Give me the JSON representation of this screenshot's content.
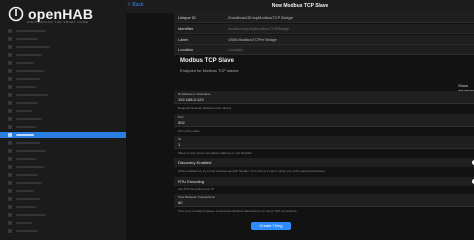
{
  "app": {
    "logo_text": "openHAB",
    "logo_sub": "EMPOWERING THE SMART HOME"
  },
  "header": {
    "back_label": "Back",
    "title": "New Modbus TCP Slave"
  },
  "thing": {
    "rows": [
      {
        "label": "Unique ID",
        "value": "ZmodbusUID:tcpModbusTCP Bridge"
      },
      {
        "label": "Identifier",
        "value": "modbus:tcp:tcpModbusTCPBridge"
      },
      {
        "label": "Label",
        "value": "OWA ModbusTCPer Bridge"
      },
      {
        "label": "Location",
        "value": "Location"
      }
    ]
  },
  "section": {
    "title": "Modbus TCP Slave",
    "subtitle": "Endpoint for Modbus TCP slaves",
    "show_advanced": "Show advanced"
  },
  "fields": {
    "ip": {
      "label": "IP Address or Hostname",
      "value": "192.168.0.123",
      "help": "Required Network address of the device"
    },
    "port": {
      "label": "Port",
      "value": "502",
      "help": "Port of the slave"
    },
    "id": {
      "label": "ID",
      "value": "1",
      "help": "Slave id. Also known as station address or unit identifier"
    },
    "timeout": {
      "label": "Time Between Transactions",
      "value": "60",
      "help": "Time (ms) to delay between consecutive Modbus transactions (on same TCP connection)"
    }
  },
  "toggles": {
    "discovery": {
      "label": "Discovery Enabled",
      "help": "When enabled we try to find a device specific handler. Turn this on if you're using one of the supported devices."
    },
    "rtu": {
      "label": "RTU Encoding",
      "help": "Use RTU Encoding over IP"
    }
  },
  "actions": {
    "create_label": "Create Thing"
  },
  "colors": {
    "accent": "#2f8cff",
    "active_nav": "#2a7de1",
    "bg": "#121212"
  }
}
